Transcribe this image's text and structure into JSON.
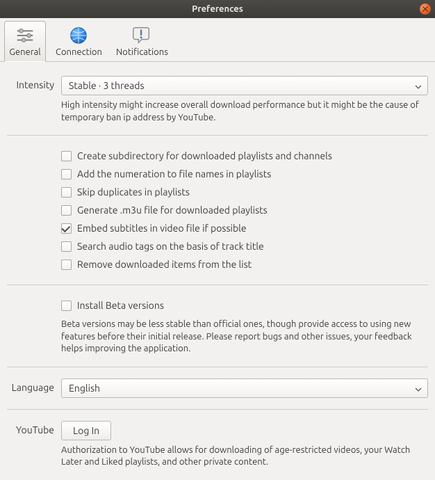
{
  "window": {
    "title": "Preferences"
  },
  "tabs": {
    "general": "General",
    "connection": "Connection",
    "notifications": "Notifications"
  },
  "intensity": {
    "label": "Intensity",
    "value": "Stable · 3 threads",
    "help": "High intensity might increase overall download performance but it might be the cause of temporary ban ip address by YouTube."
  },
  "checks": {
    "subdir": "Create subdirectory for downloaded playlists and channels",
    "numeration": "Add the numeration to file names in playlists",
    "skip_dup": "Skip duplicates in playlists",
    "gen_m3u": "Generate .m3u file for downloaded playlists",
    "embed_subs": "Embed subtitles in video file if possible",
    "search_audio_tags": "Search audio tags on the basis of track title",
    "remove_downloaded": "Remove downloaded items from the list"
  },
  "beta": {
    "label": "Install Beta versions",
    "help": "Beta versions may be less stable than official ones, though provide access to using new features before their initial release. Please report bugs and other issues, your feedback helps improving the application."
  },
  "language": {
    "label": "Language",
    "value": "English"
  },
  "youtube": {
    "label": "YouTube",
    "button": "Log In",
    "help": "Authorization to YouTube allows for downloading of age-restricted videos, your Watch Later and Liked playlists, and other private content."
  }
}
